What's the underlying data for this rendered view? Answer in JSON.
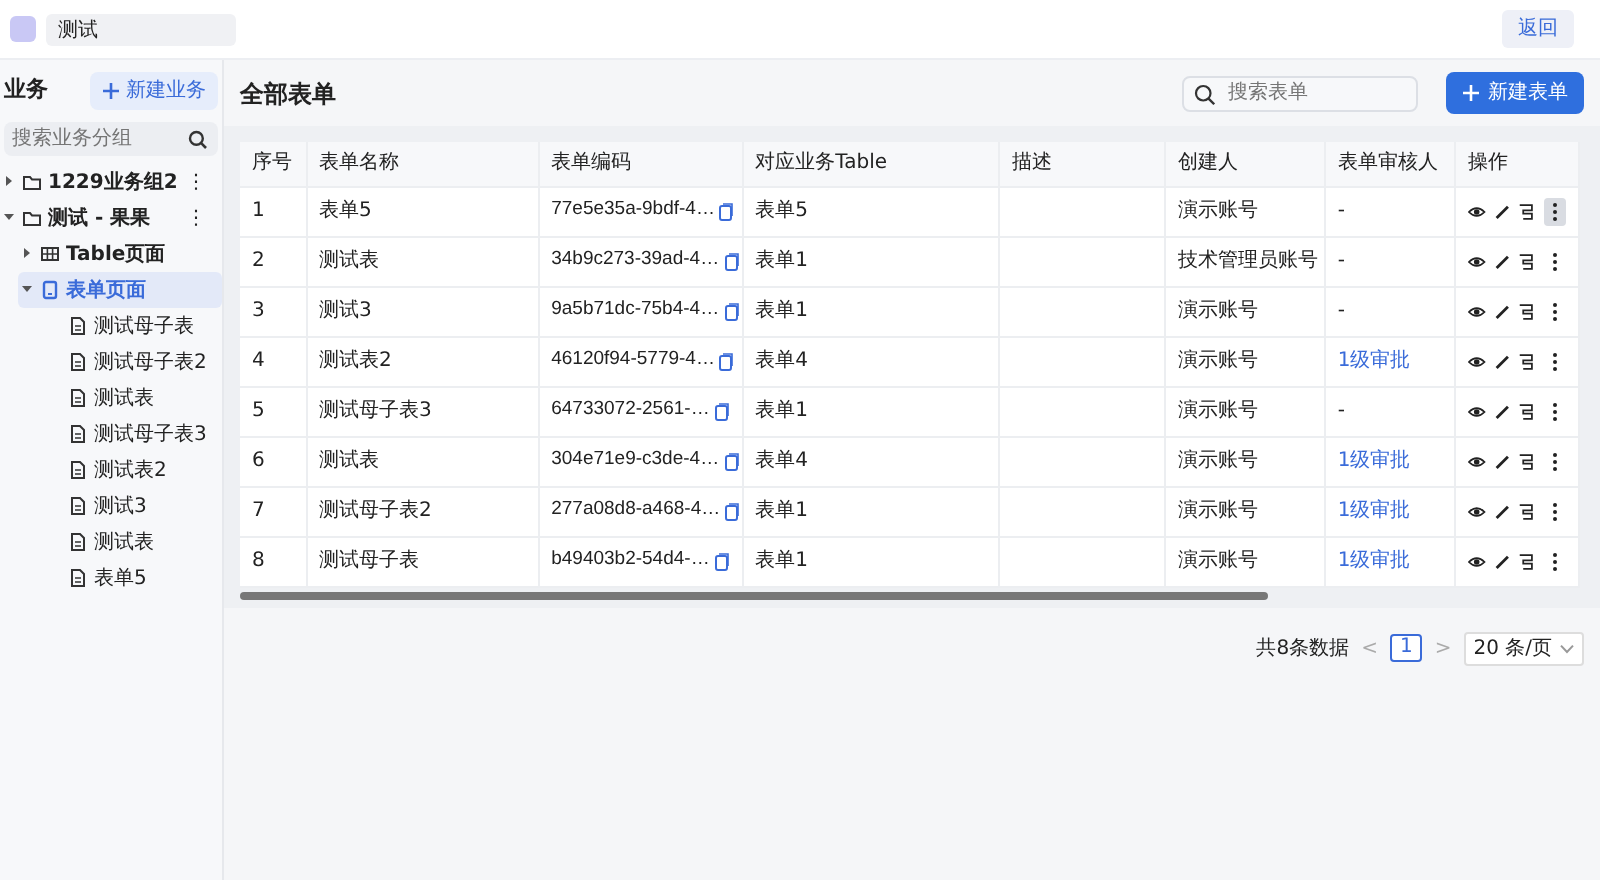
{
  "header": {
    "app_name": "测试",
    "back_button": "返回"
  },
  "sidebar": {
    "title": "业务",
    "new_button": "新建业务",
    "search": {
      "placeholder": "搜索业务分组"
    },
    "tree": [
      {
        "label": "1229业务组2",
        "kind": "folder",
        "expanded": false,
        "selected": false,
        "menu": "⋮"
      },
      {
        "label": "测试 - 果果",
        "kind": "folder",
        "expanded": true,
        "selected": false,
        "menu": "⋮",
        "children": [
          {
            "label": "Table页面",
            "kind": "table",
            "expanded": false,
            "selected": false
          },
          {
            "label": "表单页面",
            "kind": "form",
            "expanded": true,
            "selected": true,
            "children": [
              {
                "label": "测试母子表",
                "kind": "doc",
                "selected": false
              },
              {
                "label": "测试母子表2",
                "kind": "doc",
                "selected": false
              },
              {
                "label": "测试表",
                "kind": "doc",
                "selected": false
              },
              {
                "label": "测试母子表3",
                "kind": "doc",
                "selected": false
              },
              {
                "label": "测试表2",
                "kind": "doc",
                "selected": false
              },
              {
                "label": "测试3",
                "kind": "doc",
                "selected": false
              },
              {
                "label": "测试表",
                "kind": "doc",
                "selected": false
              },
              {
                "label": "表单5",
                "kind": "doc",
                "selected": false
              }
            ]
          }
        ]
      }
    ]
  },
  "main": {
    "title": "全部表单",
    "search": {
      "placeholder": "搜索表单"
    },
    "new_button": "新建表单",
    "table": {
      "columns": [
        "序号",
        "表单名称",
        "表单编码",
        "对应业务Table",
        "描述",
        "创建人",
        "表单审核人",
        "操作"
      ],
      "rows": [
        {
          "index": "1",
          "name": "表单5",
          "code": "77e5e35a-9bdf-4…",
          "table": "表单5",
          "description": "",
          "creator": "演示账号",
          "reviewer": "-",
          "reviewer_link": false,
          "more_hovered": true
        },
        {
          "index": "2",
          "name": "测试表",
          "code": "34b9c273-39ad-4…",
          "table": "表单1",
          "description": "",
          "creator": "技术管理员账号",
          "reviewer": "-",
          "reviewer_link": false,
          "more_hovered": false
        },
        {
          "index": "3",
          "name": "测试3",
          "code": "9a5b71dc-75b4-4…",
          "table": "表单1",
          "description": "",
          "creator": "演示账号",
          "reviewer": "-",
          "reviewer_link": false,
          "more_hovered": false
        },
        {
          "index": "4",
          "name": "测试表2",
          "code": "46120f94-5779-4…",
          "table": "表单4",
          "description": "",
          "creator": "演示账号",
          "reviewer": "1级审批",
          "reviewer_link": true,
          "more_hovered": false
        },
        {
          "index": "5",
          "name": "测试母子表3",
          "code": "64733072-2561-…",
          "table": "表单1",
          "description": "",
          "creator": "演示账号",
          "reviewer": "-",
          "reviewer_link": false,
          "more_hovered": false
        },
        {
          "index": "6",
          "name": "测试表",
          "code": "304e71e9-c3de-4…",
          "table": "表单4",
          "description": "",
          "creator": "演示账号",
          "reviewer": "1级审批",
          "reviewer_link": true,
          "more_hovered": false
        },
        {
          "index": "7",
          "name": "测试母子表2",
          "code": "277a08d8-a468-4…",
          "table": "表单1",
          "description": "",
          "creator": "演示账号",
          "reviewer": "1级审批",
          "reviewer_link": true,
          "more_hovered": false
        },
        {
          "index": "8",
          "name": "测试母子表",
          "code": "b49403b2-54d4-…",
          "table": "表单1",
          "description": "",
          "creator": "演示账号",
          "reviewer": "1级审批",
          "reviewer_link": true,
          "more_hovered": false
        }
      ]
    },
    "pagination": {
      "total": "共8条数据",
      "prev": "<",
      "pages": [
        {
          "label": "1",
          "selected": true
        }
      ],
      "next": ">",
      "page_size": "20 条/页"
    }
  }
}
